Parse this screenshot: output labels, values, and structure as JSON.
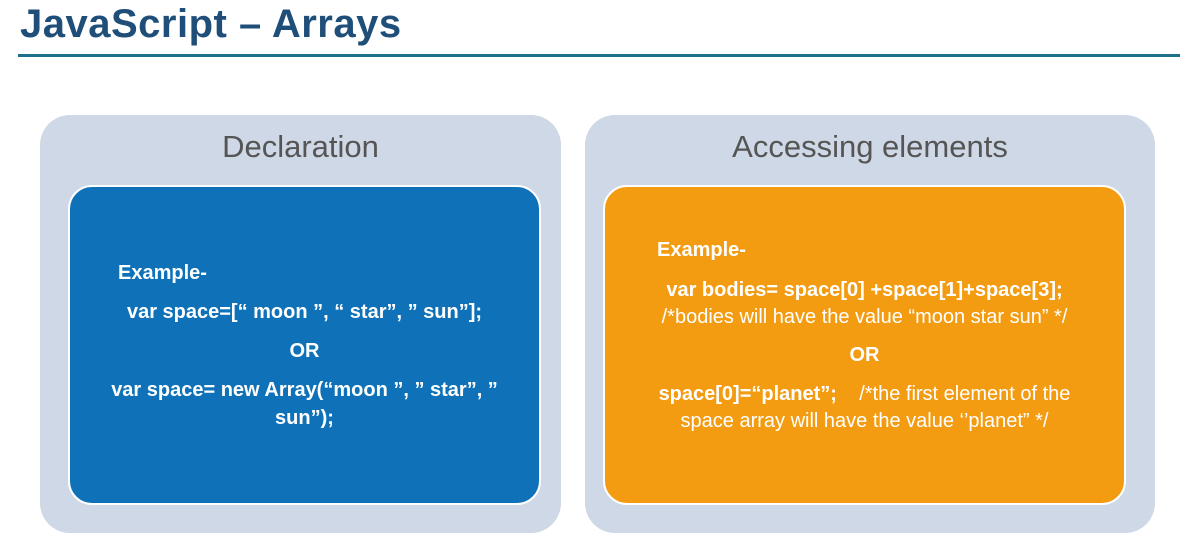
{
  "title": "JavaScript – Arrays",
  "declaration": {
    "heading": "Declaration",
    "example_label": "Example-",
    "line1": "var space=[“ moon ”, “ star”, ” sun”];",
    "or": "OR",
    "line2": "var space= new Array(“moon ”, ” star”, ”",
    "line3": "sun”);"
  },
  "accessing": {
    "heading": "Accessing elements",
    "example_label": "Example-",
    "line1": "var bodies= space[0] +space[1]+space[3];",
    "comment1": "/*bodies will have the value “moon star sun” */",
    "or": "OR",
    "line2_code": "space[0]=“planet”;",
    "line2_comment": "/*the first element of the",
    "line3": "space array will have the value ‘’planet” */"
  },
  "colors": {
    "title": "#1f4e79",
    "panel_bg": "#cfd8e6",
    "declaration_card": "#0f72b8",
    "accessing_card": "#f39c12"
  }
}
